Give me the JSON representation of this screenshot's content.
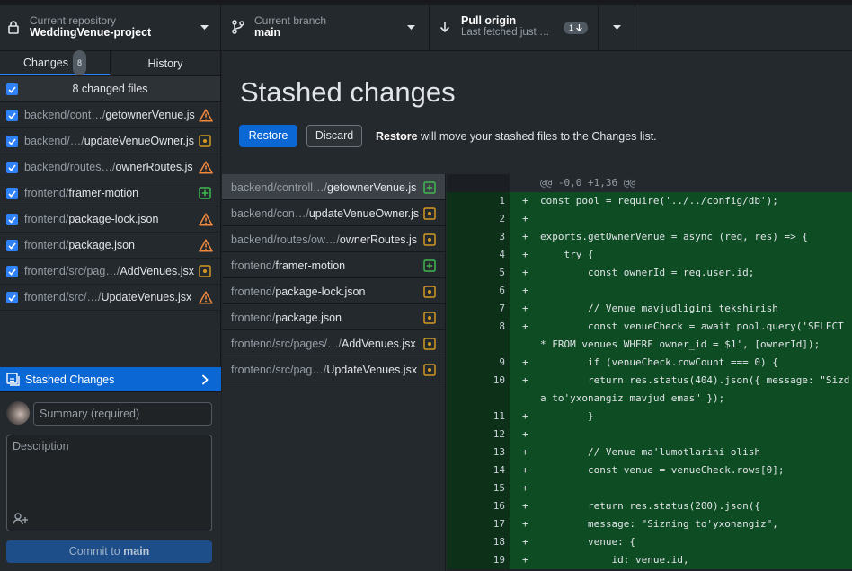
{
  "toolbar": {
    "repo": {
      "caption": "Current repository",
      "name": "WeddingVenue-project"
    },
    "branch": {
      "caption": "Current branch",
      "name": "main"
    },
    "pull": {
      "title": "Pull origin",
      "subtitle": "Last fetched just now",
      "badge_count": "1"
    }
  },
  "sidebar": {
    "tabs": [
      {
        "label": "Changes",
        "count": "8"
      },
      {
        "label": "History"
      }
    ],
    "header_label": "8 changed files",
    "files": [
      {
        "dir": "backend/cont…/",
        "name": "getownerVenue.js",
        "status": "modified-warning"
      },
      {
        "dir": "backend/…/",
        "name": "updateVenueOwner.js",
        "status": "modified"
      },
      {
        "dir": "backend/routes…/",
        "name": "ownerRoutes.js",
        "status": "modified-warning"
      },
      {
        "dir": "frontend/",
        "name": "framer-motion",
        "status": "added"
      },
      {
        "dir": "frontend/",
        "name": "package-lock.json",
        "status": "modified-warning"
      },
      {
        "dir": "frontend/",
        "name": "package.json",
        "status": "modified-warning"
      },
      {
        "dir": "frontend/src/pag…/",
        "name": "AddVenues.jsx",
        "status": "modified"
      },
      {
        "dir": "frontend/src/…/",
        "name": "UpdateVenues.jsx",
        "status": "modified-warning"
      }
    ],
    "stashed_label": "Stashed Changes",
    "summary_placeholder": "Summary (required)",
    "description_placeholder": "Description",
    "commit_prefix": "Commit to ",
    "commit_branch": "main"
  },
  "stash": {
    "title": "Stashed changes",
    "restore_label": "Restore",
    "discard_label": "Discard",
    "hint_bold": "Restore",
    "hint_text": " will move your stashed files to the Changes list.",
    "files": [
      {
        "dir": "backend/controll…/",
        "name": "getownerVenue.js",
        "status": "added"
      },
      {
        "dir": "backend/con…/",
        "name": "updateVenueOwner.js",
        "status": "modified"
      },
      {
        "dir": "backend/routes/ow…/",
        "name": "ownerRoutes.js",
        "status": "modified"
      },
      {
        "dir": "frontend/",
        "name": "framer-motion",
        "status": "added"
      },
      {
        "dir": "frontend/",
        "name": "package-lock.json",
        "status": "modified"
      },
      {
        "dir": "frontend/",
        "name": "package.json",
        "status": "modified"
      },
      {
        "dir": "frontend/src/pages/…/",
        "name": "AddVenues.jsx",
        "status": "modified"
      },
      {
        "dir": "frontend/src/pag…/",
        "name": "UpdateVenues.jsx",
        "status": "modified"
      }
    ]
  },
  "diff": {
    "hunk": "@@ -0,0 +1,36 @@",
    "lines": [
      {
        "n": "1",
        "code": "const pool = require('../../config/db');"
      },
      {
        "n": "2",
        "code": ""
      },
      {
        "n": "3",
        "code": "exports.getOwnerVenue = async (req, res) => {"
      },
      {
        "n": "4",
        "code": "    try {"
      },
      {
        "n": "5",
        "code": "        const ownerId = req.user.id;"
      },
      {
        "n": "6",
        "code": ""
      },
      {
        "n": "7",
        "code": "        // Venue mavjudligini tekshirish"
      },
      {
        "n": "8",
        "code": "        const venueCheck = await pool.query('SELECT * FROM venues WHERE owner_id = $1', [ownerId]);"
      },
      {
        "n": "9",
        "code": "        if (venueCheck.rowCount === 0) {"
      },
      {
        "n": "10",
        "code": "        return res.status(404).json({ message: \"Sizda to'yxonangiz mavjud emas\" });"
      },
      {
        "n": "11",
        "code": "        }"
      },
      {
        "n": "12",
        "code": ""
      },
      {
        "n": "13",
        "code": "        // Venue ma'lumotlarini olish"
      },
      {
        "n": "14",
        "code": "        const venue = venueCheck.rows[0];"
      },
      {
        "n": "15",
        "code": ""
      },
      {
        "n": "16",
        "code": "        return res.status(200).json({"
      },
      {
        "n": "17",
        "code": "        message: \"Sizning to'yxonangiz\","
      },
      {
        "n": "18",
        "code": "        venue: {"
      },
      {
        "n": "19",
        "code": "            id: venue.id,"
      }
    ]
  },
  "colors": {
    "accent": "#0b67d4",
    "added": "#3fb950",
    "modified": "#d29922",
    "warning": "#f0883e",
    "diff_bg": "#0e4c23"
  }
}
